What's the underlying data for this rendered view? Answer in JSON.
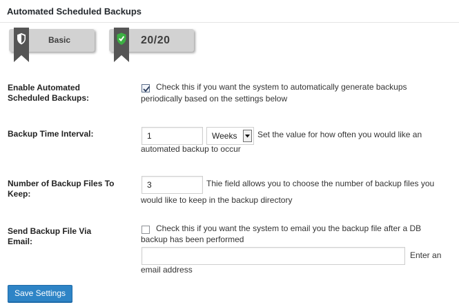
{
  "section": {
    "title": "Automated Scheduled Backups"
  },
  "badges": {
    "level_label": "Basic",
    "score_label": "20/20"
  },
  "fields": {
    "enable": {
      "label_line1": "Enable Automated",
      "label_line2": "Scheduled Backups:",
      "checked": true,
      "desc_line1": "Check this if you want the system to automatically generate backups",
      "desc_line2": "periodically based on the settings below"
    },
    "interval": {
      "label": "Backup Time Interval:",
      "value": "1",
      "unit": "Weeks",
      "desc_line1": "Set the value for how often you would like an",
      "desc_line2": "automated backup to occur"
    },
    "keep": {
      "label_line1": "Number of Backup Files To",
      "label_line2": "Keep:",
      "value": "3",
      "desc_line1": "Thie field allows you to choose the number of backup files you",
      "desc_line2": "would like to keep in the backup directory"
    },
    "email": {
      "label_line1": "Send Backup File Via",
      "label_line2": "Email:",
      "checked": false,
      "desc_line1": "Check this if you want the system to email you the backup file after a DB",
      "desc_line2": "backup has been performed",
      "address_value": "",
      "address_desc_line1": "Enter an",
      "address_desc_line2": "email address"
    }
  },
  "actions": {
    "save_label": "Save Settings"
  },
  "colors": {
    "primary_button": "#2e84c6",
    "badge_bg": "#d2d2d2",
    "ribbon": "#555555",
    "shield_green": "#3cb043"
  },
  "icons": {
    "basic_badge": "shield-icon",
    "score_badge": "shield-check-icon"
  }
}
